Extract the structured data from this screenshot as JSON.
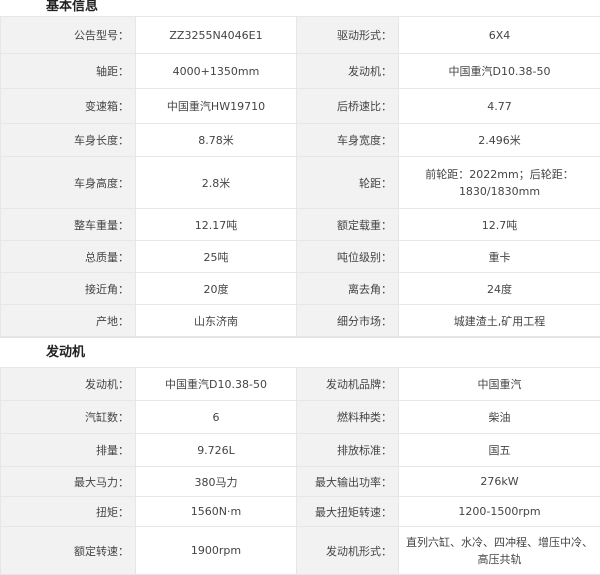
{
  "sections": [
    {
      "title": "基本信息",
      "rows": [
        [
          "公告型号：",
          "ZZ3255N4046E1",
          "驱动形式：",
          "6X4"
        ],
        [
          "轴距：",
          "4000+1350mm",
          "发动机：",
          "中国重汽D10.38-50"
        ],
        [
          "变速箱：",
          "中国重汽HW19710",
          "后桥速比：",
          "4.77"
        ],
        [
          "车身长度：",
          "8.78米",
          "车身宽度：",
          "2.496米"
        ],
        [
          "车身高度：",
          "2.8米",
          "轮距：",
          "前轮距：2022mm；后轮距：1830/1830mm"
        ],
        [
          "整车重量：",
          "12.17吨",
          "额定载重：",
          "12.7吨"
        ],
        [
          "总质量：",
          "25吨",
          "吨位级别：",
          "重卡"
        ],
        [
          "接近角：",
          "20度",
          "离去角：",
          "24度"
        ],
        [
          "产地：",
          "山东济南",
          "细分市场：",
          "城建渣土,矿用工程"
        ]
      ]
    },
    {
      "title": "发动机",
      "rows": [
        [
          "发动机：",
          "中国重汽D10.38-50",
          "发动机品牌：",
          "中国重汽"
        ],
        [
          "汽缸数：",
          "6",
          "燃料种类：",
          "柴油"
        ],
        [
          "排量：",
          "9.726L",
          "排放标准：",
          "国五"
        ],
        [
          "最大马力：",
          "380马力",
          "最大输出功率：",
          "276kW"
        ],
        [
          "扭矩：",
          "1560N·m",
          "最大扭矩转速：",
          "1200-1500rpm"
        ],
        [
          "额定转速：",
          "1900rpm",
          "发动机形式：",
          "直列六缸、水冷、四冲程、增压中冷、高压共轨"
        ]
      ]
    }
  ]
}
